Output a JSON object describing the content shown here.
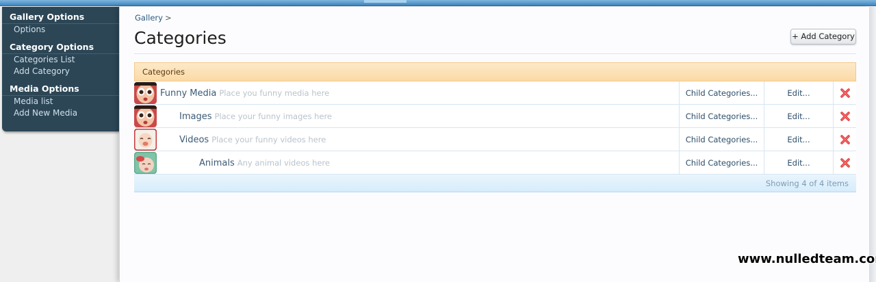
{
  "sidebar": {
    "sections": [
      {
        "heading": "Gallery Options",
        "items": [
          "Options"
        ]
      },
      {
        "heading": "Category Options",
        "items": [
          "Categories List",
          "Add Category"
        ]
      },
      {
        "heading": "Media Options",
        "items": [
          "Media list",
          "Add New Media"
        ]
      }
    ]
  },
  "breadcrumb": {
    "root": "Gallery",
    "separator": ">"
  },
  "page_title": "Categories",
  "add_button_label": "+ Add Category",
  "table": {
    "header": "Categories",
    "rows": [
      {
        "name": "Funny Media",
        "description": "Place you funny media here",
        "depth": 0,
        "child_label": "Child Categories...",
        "edit_label": "Edit...",
        "thumb": "face-red"
      },
      {
        "name": "Images",
        "description": "Place your funny images here",
        "depth": 1,
        "child_label": "Child Categories...",
        "edit_label": "Edit...",
        "thumb": "face-red"
      },
      {
        "name": "Videos",
        "description": "Place your funny videos here",
        "depth": 1,
        "child_label": "Child Categories...",
        "edit_label": "Edit...",
        "thumb": "baby-red-frame"
      },
      {
        "name": "Animals",
        "description": "Any animal videos here",
        "depth": 2,
        "child_label": "Child Categories...",
        "edit_label": "Edit...",
        "thumb": "baby-green-frame"
      }
    ],
    "footer": "Showing 4 of 4 items"
  },
  "watermark": "www.nulledteam.com",
  "colors": {
    "sidebar_bg": "#2c4656",
    "table_header_bg": "#fbd9a6",
    "table_footer_bg": "#d6ecfb",
    "delete_red": "#e53b3b"
  }
}
